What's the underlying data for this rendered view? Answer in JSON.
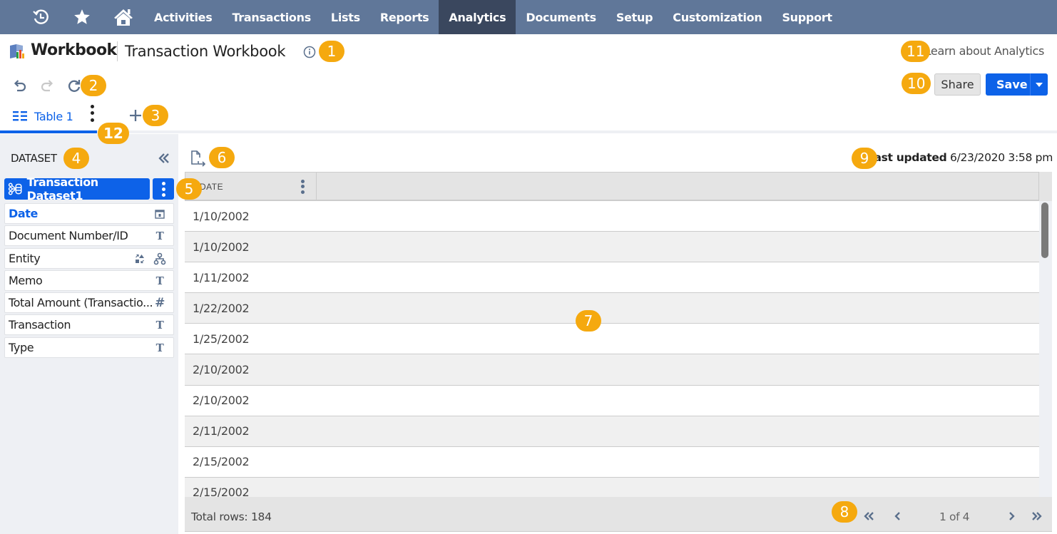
{
  "nav": {
    "icons": [
      "recent-icon",
      "star-icon",
      "home-icon"
    ],
    "items": [
      {
        "label": "Activities",
        "active": false
      },
      {
        "label": "Transactions",
        "active": false
      },
      {
        "label": "Lists",
        "active": false
      },
      {
        "label": "Reports",
        "active": false
      },
      {
        "label": "Analytics",
        "active": true
      },
      {
        "label": "Documents",
        "active": false
      },
      {
        "label": "Setup",
        "active": false
      },
      {
        "label": "Customization",
        "active": false
      },
      {
        "label": "Support",
        "active": false
      }
    ]
  },
  "header": {
    "app_name": "Workbook",
    "workbook_title": "Transaction Workbook",
    "learn_link": "Learn about Analytics"
  },
  "toolbar": {
    "share_label": "Share",
    "save_label": "Save"
  },
  "tabs": [
    {
      "label": "Table 1",
      "active": true
    }
  ],
  "dataset": {
    "title": "DATASET",
    "name": "Transaction Dataset1",
    "fields": [
      {
        "label": "Date",
        "type": "date",
        "selected": true
      },
      {
        "label": "Document Number/ID",
        "type": "text",
        "selected": false
      },
      {
        "label": "Entity",
        "type": "record",
        "selected": false
      },
      {
        "label": "Memo",
        "type": "text",
        "selected": false
      },
      {
        "label": "Total Amount (Transactio...",
        "type": "number",
        "selected": false
      },
      {
        "label": "Transaction",
        "type": "text",
        "selected": false
      },
      {
        "label": "Type",
        "type": "text",
        "selected": false
      }
    ]
  },
  "main": {
    "last_updated_label": "Last updated",
    "last_updated_value": "6/23/2020 3:58 pm",
    "grid": {
      "columns": [
        "DATE"
      ],
      "rows": [
        "1/10/2002",
        "1/10/2002",
        "1/11/2002",
        "1/22/2002",
        "1/25/2002",
        "2/10/2002",
        "2/10/2002",
        "2/11/2002",
        "2/15/2002",
        "2/15/2002"
      ],
      "total_rows": "Total rows: 184",
      "page_info": "1 of 4"
    }
  },
  "callouts": [
    "1",
    "2",
    "3",
    "4",
    "5",
    "6",
    "7",
    "8",
    "9",
    "10",
    "11",
    "12"
  ],
  "colors": {
    "nav_bg": "#607799",
    "nav_active": "#3a475e",
    "accent": "#0d62e8",
    "callout": "#f5a90f"
  }
}
